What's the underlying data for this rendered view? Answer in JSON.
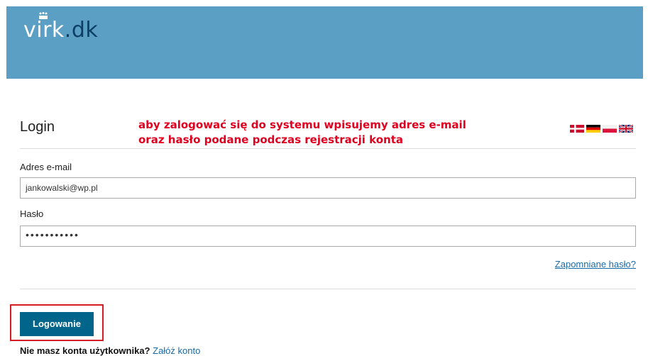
{
  "header": {
    "logo_left": "virk",
    "logo_right": ".dk"
  },
  "login": {
    "title": "Login",
    "annotation_line1": "aby zalogować się do systemu wpisujemy adres e-mail",
    "annotation_line2": "oraz hasło podane podczas rejestracji konta",
    "email_label": "Adres e-mail",
    "email_value": "jankowalski@wp.pl",
    "password_label": "Hasło",
    "password_value": "•••••••••••",
    "forgot_link": "Zapomniane hasło?",
    "submit_label": "Logowanie",
    "no_account_text": "Nie masz konta użytkownika?",
    "create_account_link": "Załóż konto"
  },
  "languages": [
    "danish-flag",
    "german-flag",
    "polish-flag",
    "uk-flag"
  ],
  "colors": {
    "header": "#5b9fc5",
    "button": "#00648b",
    "annotation": "#e0001f",
    "link": "#1a6aa8"
  }
}
